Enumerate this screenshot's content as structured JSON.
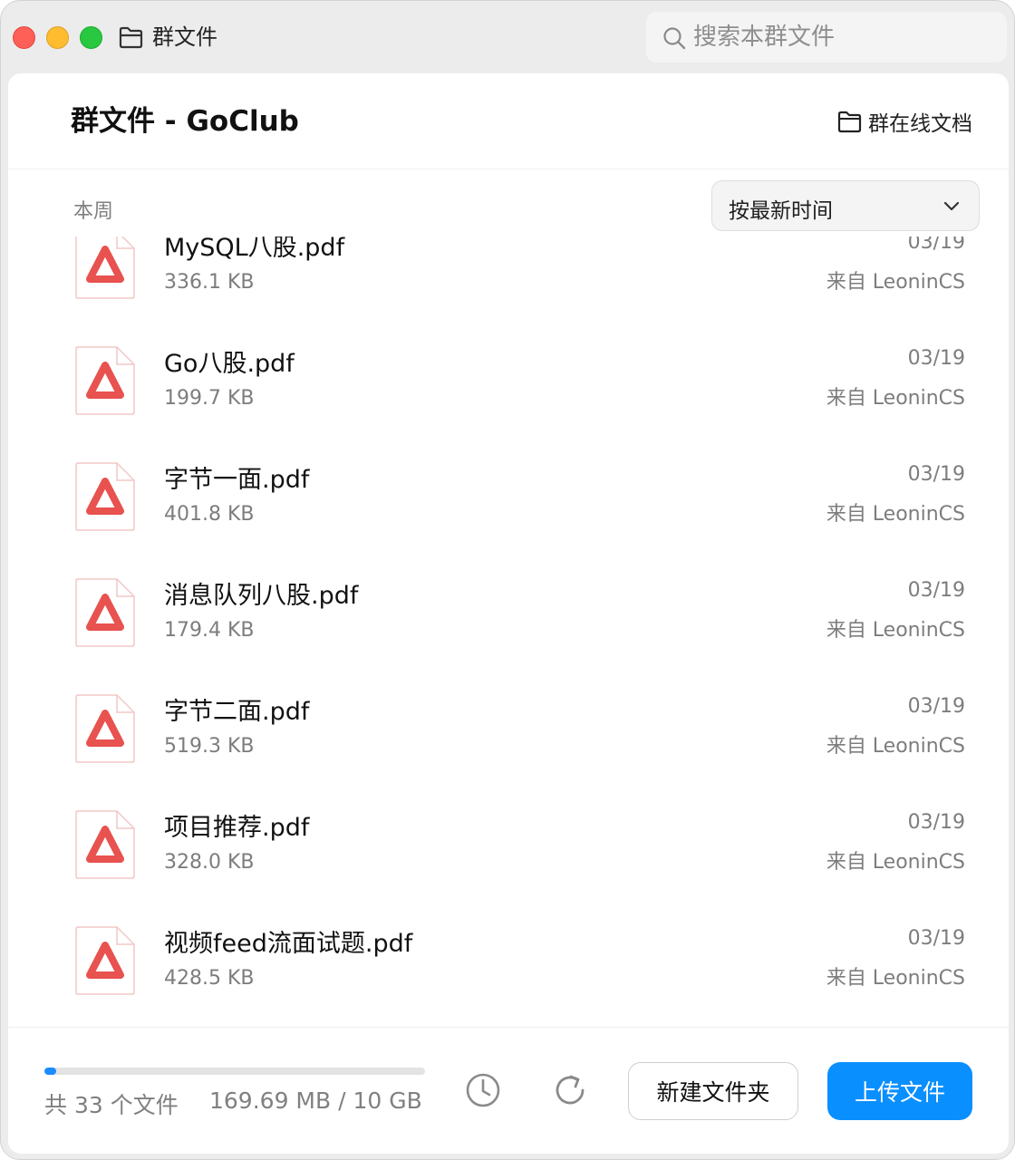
{
  "window": {
    "title": "群文件"
  },
  "search": {
    "placeholder": "搜索本群文件"
  },
  "header": {
    "title": "群文件 - GoClub",
    "online_docs": "群在线文档"
  },
  "section": {
    "label": "本周"
  },
  "sort": {
    "selected": "按最新时间"
  },
  "files": [
    {
      "name": "MySQL八股.pdf",
      "size": "336.1 KB",
      "date": "03/19",
      "from": "来自 LeoninCS"
    },
    {
      "name": "Go八股.pdf",
      "size": "199.7 KB",
      "date": "03/19",
      "from": "来自 LeoninCS"
    },
    {
      "name": "字节一面.pdf",
      "size": "401.8 KB",
      "date": "03/19",
      "from": "来自 LeoninCS"
    },
    {
      "name": "消息队列八股.pdf",
      "size": "179.4 KB",
      "date": "03/19",
      "from": "来自 LeoninCS"
    },
    {
      "name": "字节二面.pdf",
      "size": "519.3 KB",
      "date": "03/19",
      "from": "来自 LeoninCS"
    },
    {
      "name": "项目推荐.pdf",
      "size": "328.0 KB",
      "date": "03/19",
      "from": "来自 LeoninCS"
    },
    {
      "name": "视频feed流面试题.pdf",
      "size": "428.5 KB",
      "date": "03/19",
      "from": "来自 LeoninCS"
    }
  ],
  "footer": {
    "file_count": "共 33 个文件",
    "storage": "169.69 MB / 10 GB",
    "usage_fraction": 0.017,
    "new_folder": "新建文件夹",
    "upload": "上传文件"
  },
  "colors": {
    "accent": "#0a8fff",
    "pdf_red": "#e8524f",
    "progress": "#1a8cff"
  },
  "icons": {
    "title": "folder-icon",
    "search": "search-icon",
    "online_docs": "folder-icon",
    "file": "pdf-file-icon",
    "sort": "chevron-down-icon",
    "history": "clock-icon",
    "refresh": "refresh-icon"
  }
}
